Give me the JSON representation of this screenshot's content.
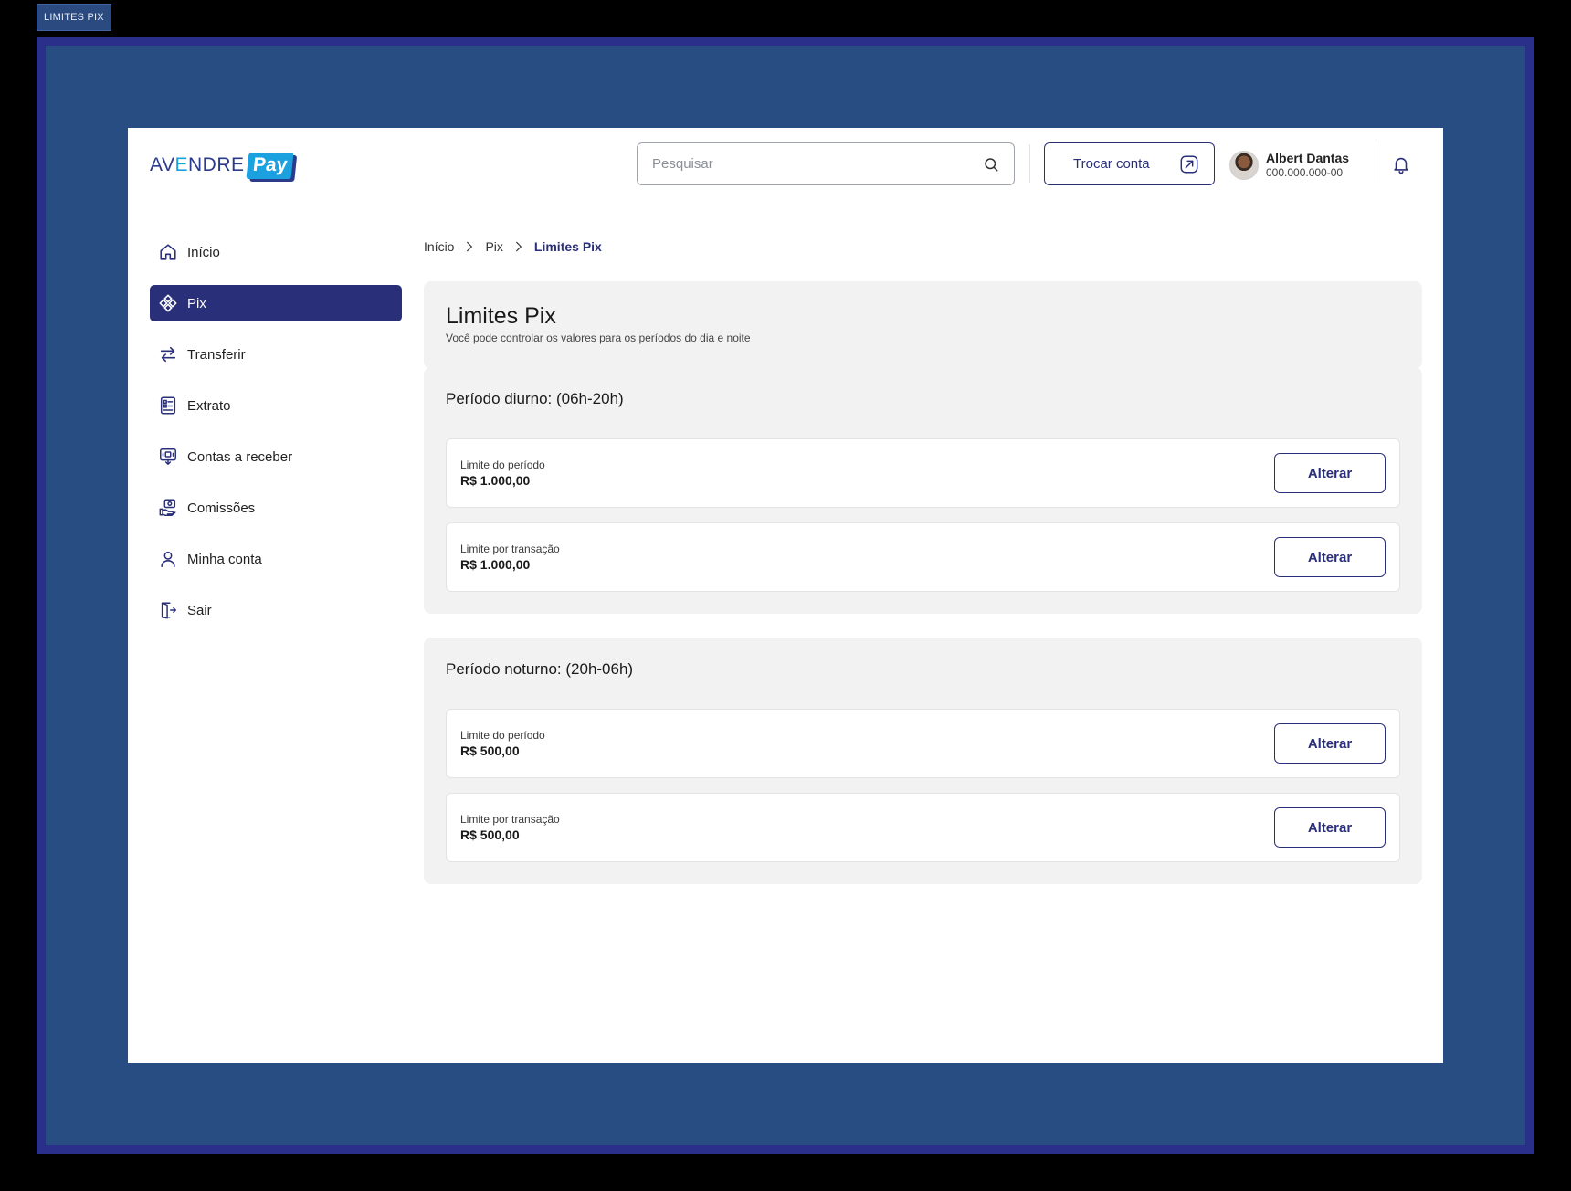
{
  "frame_tag": "LIMITES PIX",
  "logo": {
    "word_a": "AV",
    "word_e": "E",
    "word_b": "NDRE",
    "pay": "Pay"
  },
  "search": {
    "placeholder": "Pesquisar"
  },
  "switch_account": {
    "label": "Trocar conta"
  },
  "user": {
    "name": "Albert Dantas",
    "document": "000.000.000-00"
  },
  "sidebar": {
    "items": [
      {
        "label": "Início",
        "icon": "home-icon",
        "active": false
      },
      {
        "label": "Pix",
        "icon": "pix-icon",
        "active": true
      },
      {
        "label": "Transferir",
        "icon": "transfer-arrows-icon",
        "active": false
      },
      {
        "label": "Extrato",
        "icon": "statement-icon",
        "active": false
      },
      {
        "label": "Contas a receber",
        "icon": "receivables-icon",
        "active": false
      },
      {
        "label": "Comissões",
        "icon": "commission-icon",
        "active": false
      },
      {
        "label": "Minha conta",
        "icon": "user-icon",
        "active": false
      },
      {
        "label": "Sair",
        "icon": "logout-icon",
        "active": false
      }
    ]
  },
  "breadcrumb": {
    "home": "Início",
    "section": "Pix",
    "current": "Limites Pix"
  },
  "page": {
    "title": "Limites Pix",
    "subtitle": "Você pode controlar os valores para os períodos do dia e noite"
  },
  "periods": [
    {
      "title": "Período diurno: (06h-20h)",
      "limits": [
        {
          "label": "Limite do período",
          "value": "R$ 1.000,00",
          "button": "Alterar"
        },
        {
          "label": "Limite por transação",
          "value": "R$ 1.000,00",
          "button": "Alterar"
        }
      ]
    },
    {
      "title": "Período noturno: (20h-06h)",
      "limits": [
        {
          "label": "Limite do período",
          "value": "R$ 500,00",
          "button": "Alterar"
        },
        {
          "label": "Limite por transação",
          "value": "R$ 500,00",
          "button": "Alterar"
        }
      ]
    }
  ],
  "colors": {
    "primary": "#2a2f7a",
    "accent": "#1ba0e0",
    "panel": "#f2f2f2",
    "outer_frame": "#284d82"
  }
}
